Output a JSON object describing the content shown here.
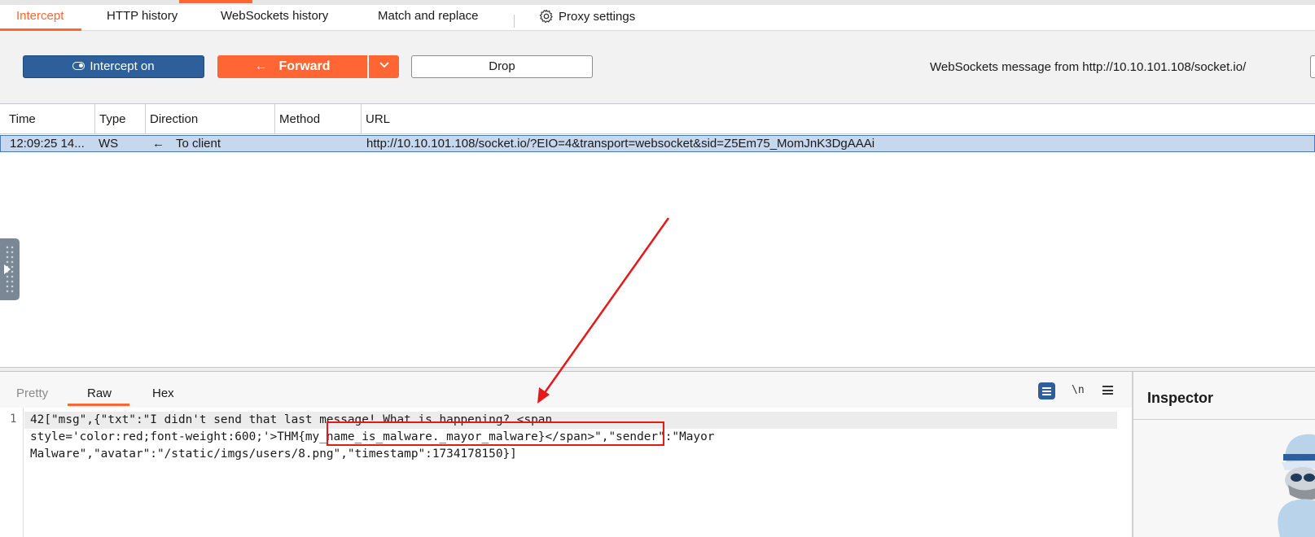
{
  "proxy_tabs": {
    "intercept": "Intercept",
    "http_history": "HTTP history",
    "websockets_history": "WebSockets history",
    "match_replace": "Match and replace",
    "proxy_settings": "Proxy settings"
  },
  "toolbar": {
    "intercept_label": "Intercept on",
    "forward_label": "Forward",
    "drop_label": "Drop",
    "message_info": "WebSockets message from http://10.10.101.108/socket.io/"
  },
  "table": {
    "headers": [
      "Time",
      "Type",
      "Direction",
      "Method",
      "URL"
    ],
    "row": {
      "time": "12:09:25 14...",
      "type": "WS",
      "direction_arrow": "←",
      "direction": "To client",
      "method": "",
      "url": "http://10.10.101.108/socket.io/?EIO=4&transport=websocket&sid=Z5Em75_MomJnK3DgAAAi"
    }
  },
  "editor": {
    "tabs": [
      "Pretty",
      "Raw",
      "Hex"
    ],
    "active_tab": "Raw",
    "nl_label": "\\n",
    "line_number": "1",
    "code_lines": [
      "42[\"msg\",{\"txt\":\"I didn't send that last message! What is happening? <span",
      "style='color:red;font-weight:600;'>THM{my_name_is_malware._mayor_malware}</span>\",\"sender\":\"Mayor",
      "Malware\",\"avatar\":\"/static/imgs/users/8.png\",\"timestamp\":1734178150}]"
    ]
  },
  "inspector": {
    "title": "Inspector"
  },
  "colors": {
    "accent": "#ff6633",
    "primary_button": "#2d5f9a",
    "selected_row": "#c6d7ee",
    "annotation_red": "#e41a1a"
  },
  "icons": {
    "settings": "gear-icon",
    "toggle": "toggle-icon",
    "back_arrow": "arrow-left-icon",
    "dropdown": "chevron-down-icon",
    "wrap": "wrap-lines-icon",
    "menu": "hamburger-menu-icon",
    "mascot": "hacker-mascot-icon"
  }
}
